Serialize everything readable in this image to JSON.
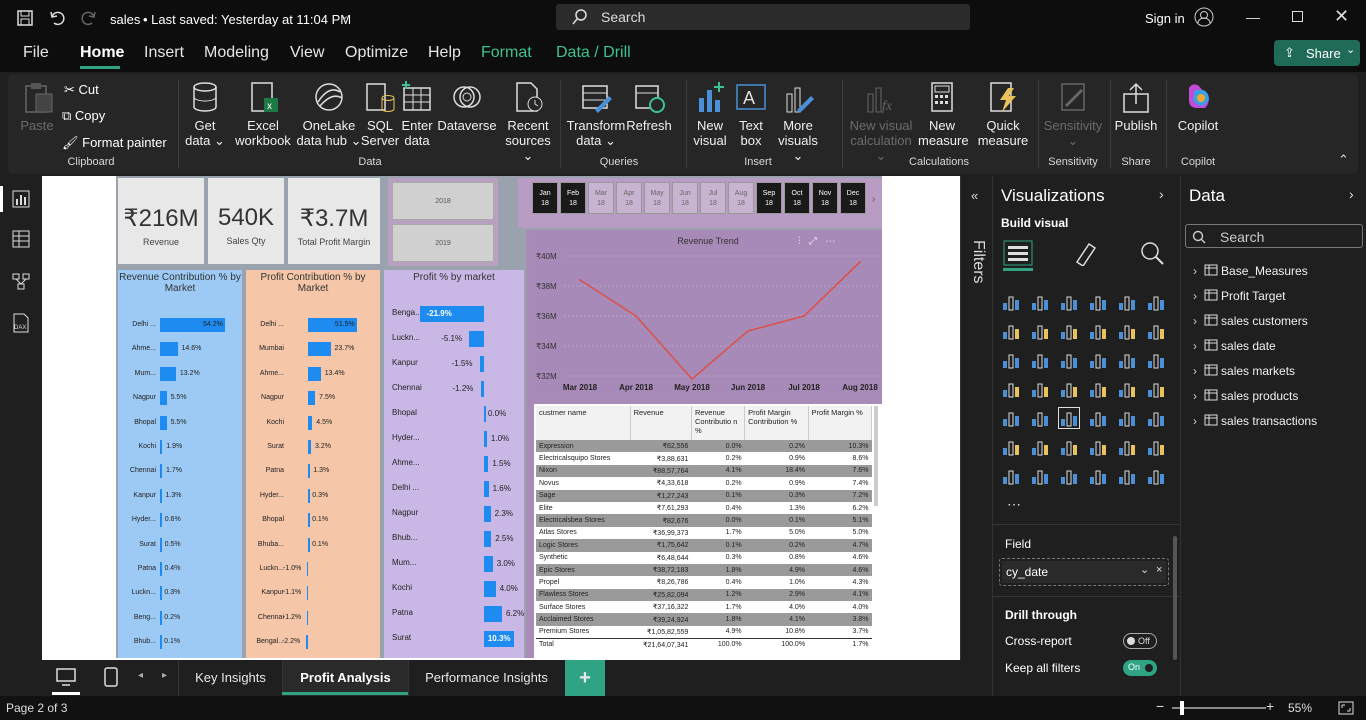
{
  "titlebar": {
    "doc": "sales",
    "status": "• Last saved: Yesterday at 11:04 PM",
    "search": "Search",
    "signin": "Sign in"
  },
  "menu": {
    "items": [
      "File",
      "Home",
      "Insert",
      "Modeling",
      "View",
      "Optimize",
      "Help",
      "Format",
      "Data / Drill"
    ],
    "share": "Share"
  },
  "ribbon": {
    "paste": "Paste",
    "cut": "Cut",
    "copy": "Copy",
    "format_painter": "Format painter",
    "clipboard": "Clipboard",
    "get_data": [
      "Get",
      "data ⌄"
    ],
    "excel": [
      "Excel",
      "workbook"
    ],
    "onelake": [
      "OneLake",
      "data hub ⌄"
    ],
    "sql": [
      "SQL",
      "Server"
    ],
    "enter": [
      "Enter",
      "data"
    ],
    "dataverse": "Dataverse",
    "recent": [
      "Recent",
      "sources ⌄"
    ],
    "data_group": "Data",
    "transform": [
      "Transform",
      "data ⌄"
    ],
    "refresh": "Refresh",
    "queries": "Queries",
    "new_visual": [
      "New",
      "visual"
    ],
    "text_box": [
      "Text",
      "box"
    ],
    "more_visuals": [
      "More",
      "visuals ⌄"
    ],
    "insert": "Insert",
    "new_vis_calc": [
      "New visual",
      "calculation ⌄"
    ],
    "new_measure": [
      "New",
      "measure"
    ],
    "quick_measure": [
      "Quick",
      "measure"
    ],
    "calculations": "Calculations",
    "sensitivity": [
      "Sensitivity",
      "⌄"
    ],
    "sensitivity_group": "Sensitivity",
    "publish": "Publish",
    "share_group": "Share",
    "copilot": "Copilot",
    "copilot_group": "Copilot"
  },
  "report": {
    "kpis": [
      {
        "value": "₹216M",
        "label": "Revenue"
      },
      {
        "value": "540K",
        "label": "Sales Qty"
      },
      {
        "value": "₹3.7M",
        "label": "Total Profit Margin"
      }
    ],
    "years": [
      "2018",
      "2019"
    ],
    "months": [
      {
        "m": "Jan",
        "y": "18",
        "sel": true
      },
      {
        "m": "Feb",
        "y": "18",
        "sel": true
      },
      {
        "m": "Mar",
        "y": "18",
        "sel": false
      },
      {
        "m": "Apr",
        "y": "18",
        "sel": false
      },
      {
        "m": "May",
        "y": "18",
        "sel": false
      },
      {
        "m": "Jun",
        "y": "18",
        "sel": false
      },
      {
        "m": "Jul",
        "y": "18",
        "sel": false
      },
      {
        "m": "Aug",
        "y": "18",
        "sel": false
      },
      {
        "m": "Sep",
        "y": "18",
        "sel": true
      },
      {
        "m": "Oct",
        "y": "18",
        "sel": true
      },
      {
        "m": "Nov",
        "y": "18",
        "sel": true
      },
      {
        "m": "Dec",
        "y": "18",
        "sel": true
      }
    ],
    "rev_contrib": {
      "title": "Revenue Contribution % by Market",
      "rows": [
        {
          "name": "Delhi ...",
          "pct": 54.2,
          "label": "54.2%"
        },
        {
          "name": "Ahme...",
          "pct": 14.6,
          "label": "14.6%"
        },
        {
          "name": "Mum...",
          "pct": 13.2,
          "label": "13.2%"
        },
        {
          "name": "Nagpur",
          "pct": 5.5,
          "label": "5.5%"
        },
        {
          "name": "Bhopal",
          "pct": 5.5,
          "label": "5.5%"
        },
        {
          "name": "Kochi",
          "pct": 1.9,
          "label": "1.9%"
        },
        {
          "name": "Chennai",
          "pct": 1.7,
          "label": "1.7%"
        },
        {
          "name": "Kanpur",
          "pct": 1.3,
          "label": "1.3%"
        },
        {
          "name": "Hyder...",
          "pct": 0.6,
          "label": "0.6%"
        },
        {
          "name": "Surat",
          "pct": 0.5,
          "label": "0.5%"
        },
        {
          "name": "Patna",
          "pct": 0.4,
          "label": "0.4%"
        },
        {
          "name": "Luckn...",
          "pct": 0.3,
          "label": "0.3%"
        },
        {
          "name": "Beng...",
          "pct": 0.2,
          "label": "0.2%"
        },
        {
          "name": "Bhub...",
          "pct": 0.1,
          "label": "0.1%"
        }
      ]
    },
    "profit_contrib": {
      "title": "Profit Contribution % by Market",
      "rows": [
        {
          "name": "Delhi ...",
          "pct": 51.5,
          "label": "51.5%"
        },
        {
          "name": "Mumbai",
          "pct": 23.7,
          "label": "23.7%"
        },
        {
          "name": "Ahme...",
          "pct": 13.4,
          "label": "13.4%"
        },
        {
          "name": "Nagpur",
          "pct": 7.5,
          "label": "7.5%"
        },
        {
          "name": "Kochi",
          "pct": 4.5,
          "label": "4.5%"
        },
        {
          "name": "Surat",
          "pct": 3.2,
          "label": "3.2%"
        },
        {
          "name": "Patna",
          "pct": 1.3,
          "label": "1.3%"
        },
        {
          "name": "Hyder...",
          "pct": 0.3,
          "label": "0.3%"
        },
        {
          "name": "Bhopal",
          "pct": 0.1,
          "label": "0.1%"
        },
        {
          "name": "Bhuba...",
          "pct": 0.1,
          "label": "0.1%"
        },
        {
          "name": "Luckn...",
          "pct": -1.0,
          "label": "-1.0%"
        },
        {
          "name": "Kanpur",
          "pct": -1.1,
          "label": "-1.1%"
        },
        {
          "name": "Chennai",
          "pct": -1.2,
          "label": "-1.2%"
        },
        {
          "name": "Bengal...",
          "pct": -2.2,
          "label": "-2.2%"
        }
      ]
    },
    "profit_pct": {
      "title": "Profit % by market",
      "rows": [
        {
          "name": "Benga...",
          "pct": -21.9,
          "label": "-21.9%"
        },
        {
          "name": "Luckn...",
          "pct": -5.1,
          "label": "-5.1%"
        },
        {
          "name": "Kanpur",
          "pct": -1.5,
          "label": "-1.5%"
        },
        {
          "name": "Chennai",
          "pct": -1.2,
          "label": "-1.2%"
        },
        {
          "name": "Bhopal",
          "pct": 0.0,
          "label": "0.0%"
        },
        {
          "name": "Hyder...",
          "pct": 1.0,
          "label": "1.0%"
        },
        {
          "name": "Ahme...",
          "pct": 1.5,
          "label": "1.5%"
        },
        {
          "name": "Delhi ...",
          "pct": 1.6,
          "label": "1.6%"
        },
        {
          "name": "Nagpur",
          "pct": 2.3,
          "label": "2.3%"
        },
        {
          "name": "Bhub...",
          "pct": 2.5,
          "label": "2.5%"
        },
        {
          "name": "Mum...",
          "pct": 3.0,
          "label": "3.0%"
        },
        {
          "name": "Kochi",
          "pct": 4.0,
          "label": "4.0%"
        },
        {
          "name": "Patna",
          "pct": 6.2,
          "label": "6.2%"
        },
        {
          "name": "Surat",
          "pct": 10.3,
          "label": "10.3%"
        }
      ]
    },
    "trend": {
      "title": "Revenue Trend",
      "yticks": [
        "₹40M",
        "₹38M",
        "₹36M",
        "₹34M",
        "₹32M"
      ],
      "xticks": [
        "Mar 2018",
        "Apr 2018",
        "May 2018",
        "Jun 2018",
        "Jul 2018",
        "Aug 2018"
      ]
    },
    "table": {
      "headers": [
        "custmer name",
        "Revenue",
        "Revenue Contributio n %",
        "Profit Margin Contribution %",
        "Profit Margin %"
      ],
      "rows": [
        [
          "Expression",
          "₹62,556",
          "0.0%",
          "0.2%",
          "10.3%"
        ],
        [
          "Electricalsquipo Stores",
          "₹3,88,631",
          "0.2%",
          "0.9%",
          "8.6%"
        ],
        [
          "Nixon",
          "₹88,57,764",
          "4.1%",
          "18.4%",
          "7.6%"
        ],
        [
          "Novus",
          "₹4,33,618",
          "0.2%",
          "0.9%",
          "7.4%"
        ],
        [
          "Sage",
          "₹1,27,243",
          "0.1%",
          "0.3%",
          "7.2%"
        ],
        [
          "Elite",
          "₹7,61,293",
          "0.4%",
          "1.3%",
          "6.2%"
        ],
        [
          "Electricalsbea Stores",
          "₹82,676",
          "0.0%",
          "0.1%",
          "5.1%"
        ],
        [
          "Atlas Stores",
          "₹36,99,373",
          "1.7%",
          "5.0%",
          "5.0%"
        ],
        [
          "Logic Stores",
          "₹1,75,642",
          "0.1%",
          "0.2%",
          "4.7%"
        ],
        [
          "Synthetic",
          "₹6,48,644",
          "0.3%",
          "0.8%",
          "4.6%"
        ],
        [
          "Epic Stores",
          "₹38,72,183",
          "1.8%",
          "4.9%",
          "4.6%"
        ],
        [
          "Propel",
          "₹8,26,786",
          "0.4%",
          "1.0%",
          "4.3%"
        ],
        [
          "Flawless Stores",
          "₹25,82,094",
          "1.2%",
          "2.9%",
          "4.1%"
        ],
        [
          "Surface Stores",
          "₹37,16,322",
          "1.7%",
          "4.0%",
          "4.0%"
        ],
        [
          "Acclaimed Stores",
          "₹39,24,924",
          "1.8%",
          "4.1%",
          "3.8%"
        ],
        [
          "Premium Stores",
          "₹1,05,82,559",
          "4.9%",
          "10.8%",
          "3.7%"
        ]
      ],
      "total": [
        "Total",
        "₹21,64,07,341",
        "100.0%",
        "100.0%",
        "1.7%"
      ]
    }
  },
  "chart_data": {
    "type": "line",
    "title": "Revenue Trend",
    "x": [
      "Mar 2018",
      "Apr 2018",
      "May 2018",
      "Jun 2018",
      "Jul 2018",
      "Aug 2018"
    ],
    "series": [
      {
        "values": [
          38.4,
          36.0,
          31.8,
          35.0,
          36.0,
          39.6
        ]
      }
    ],
    "ylim": [
      32,
      40
    ],
    "yunit": "₹M"
  },
  "filters": {
    "label": "Filters"
  },
  "viz": {
    "title": "Visualizations",
    "build": "Build visual",
    "field_label": "Field",
    "field_value": "cy_date",
    "drill": "Drill through",
    "cross": "Cross-report",
    "cross_state": "Off",
    "keep": "Keep all filters",
    "keep_state": "On"
  },
  "data": {
    "title": "Data",
    "search": "Search",
    "tables": [
      "Base_Measures",
      "Profit Target",
      "sales customers",
      "sales date",
      "sales markets",
      "sales products",
      "sales transactions"
    ]
  },
  "tabs": [
    "Key Insights",
    "Profit Analysis",
    "Performance Insights"
  ],
  "status": {
    "page": "Page 2 of 3",
    "zoom": "55%"
  },
  "colors": {
    "accent": "#2fa383",
    "bar": "#1e8bf0",
    "line": "#d9534f"
  }
}
